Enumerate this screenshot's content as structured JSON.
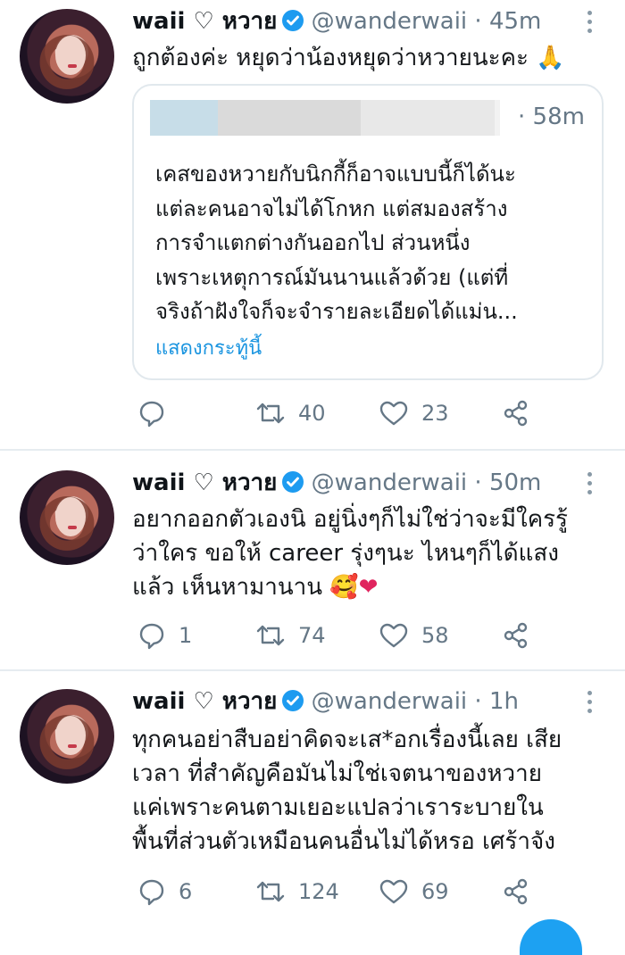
{
  "tweets": [
    {
      "name": "waii ♡ หวาย",
      "handle": "@wanderwaii",
      "time": "· 45m",
      "text": "ถูกต้องค่ะ หยุดว่าน้องหยุดว่าหวายนะคะ 🙏",
      "quote": {
        "time": "· 58m",
        "text": "เคสของหวายกับนิกกี้ก็อาจแบบนี้ก็ได้นะ\nแต่ละคนอาจไม่ได้โกหก แต่สมองสร้าง\nการจำแตกต่างกันออกไป ส่วนหนึ่ง\nเพราะเหตุการณ์มันนานแล้วด้วย (แต่ที่\nจริงถ้าฝังใจก็จะจำรายละเอียดได้แม่น...",
        "show_more": "แสดงกระทู้นี้"
      },
      "actions": {
        "reply": "",
        "retweet": "40",
        "like": "23"
      }
    },
    {
      "name": "waii ♡ หวาย",
      "handle": "@wanderwaii",
      "time": "· 50m",
      "text": "อยากออกตัวเองนิ อยู่นิ่งๆก็ไม่ใช่ว่าจะมีใครรู้\nว่าใคร ขอให้ career รุ่งๆนะ ไหนๆก็ได้แสง\nแล้ว เห็นหามานาน 🥰",
      "heart": "❤",
      "actions": {
        "reply": "1",
        "retweet": "74",
        "like": "58"
      }
    },
    {
      "name": "waii ♡ หวาย",
      "handle": "@wanderwaii",
      "time": "· 1h",
      "text": "ทุกคนอย่าสืบอย่าคิดจะเส*อกเรื่องนี้เลย เสีย\nเวลา ที่สำคัญคือมันไม่ใช่เจตนาของหวาย\nแค่เพราะคนตามเยอะแปลว่าเราระบายใน\nพื้นที่ส่วนตัวเหมือนคนอื่นไม่ได้หรอ เศร้าจัง",
      "actions": {
        "reply": "6",
        "retweet": "124",
        "like": "69"
      }
    }
  ],
  "colors": {
    "accent": "#1da1f2",
    "verified": "#1d9bf0",
    "meta": "#657786",
    "link": "#1b95e0"
  }
}
